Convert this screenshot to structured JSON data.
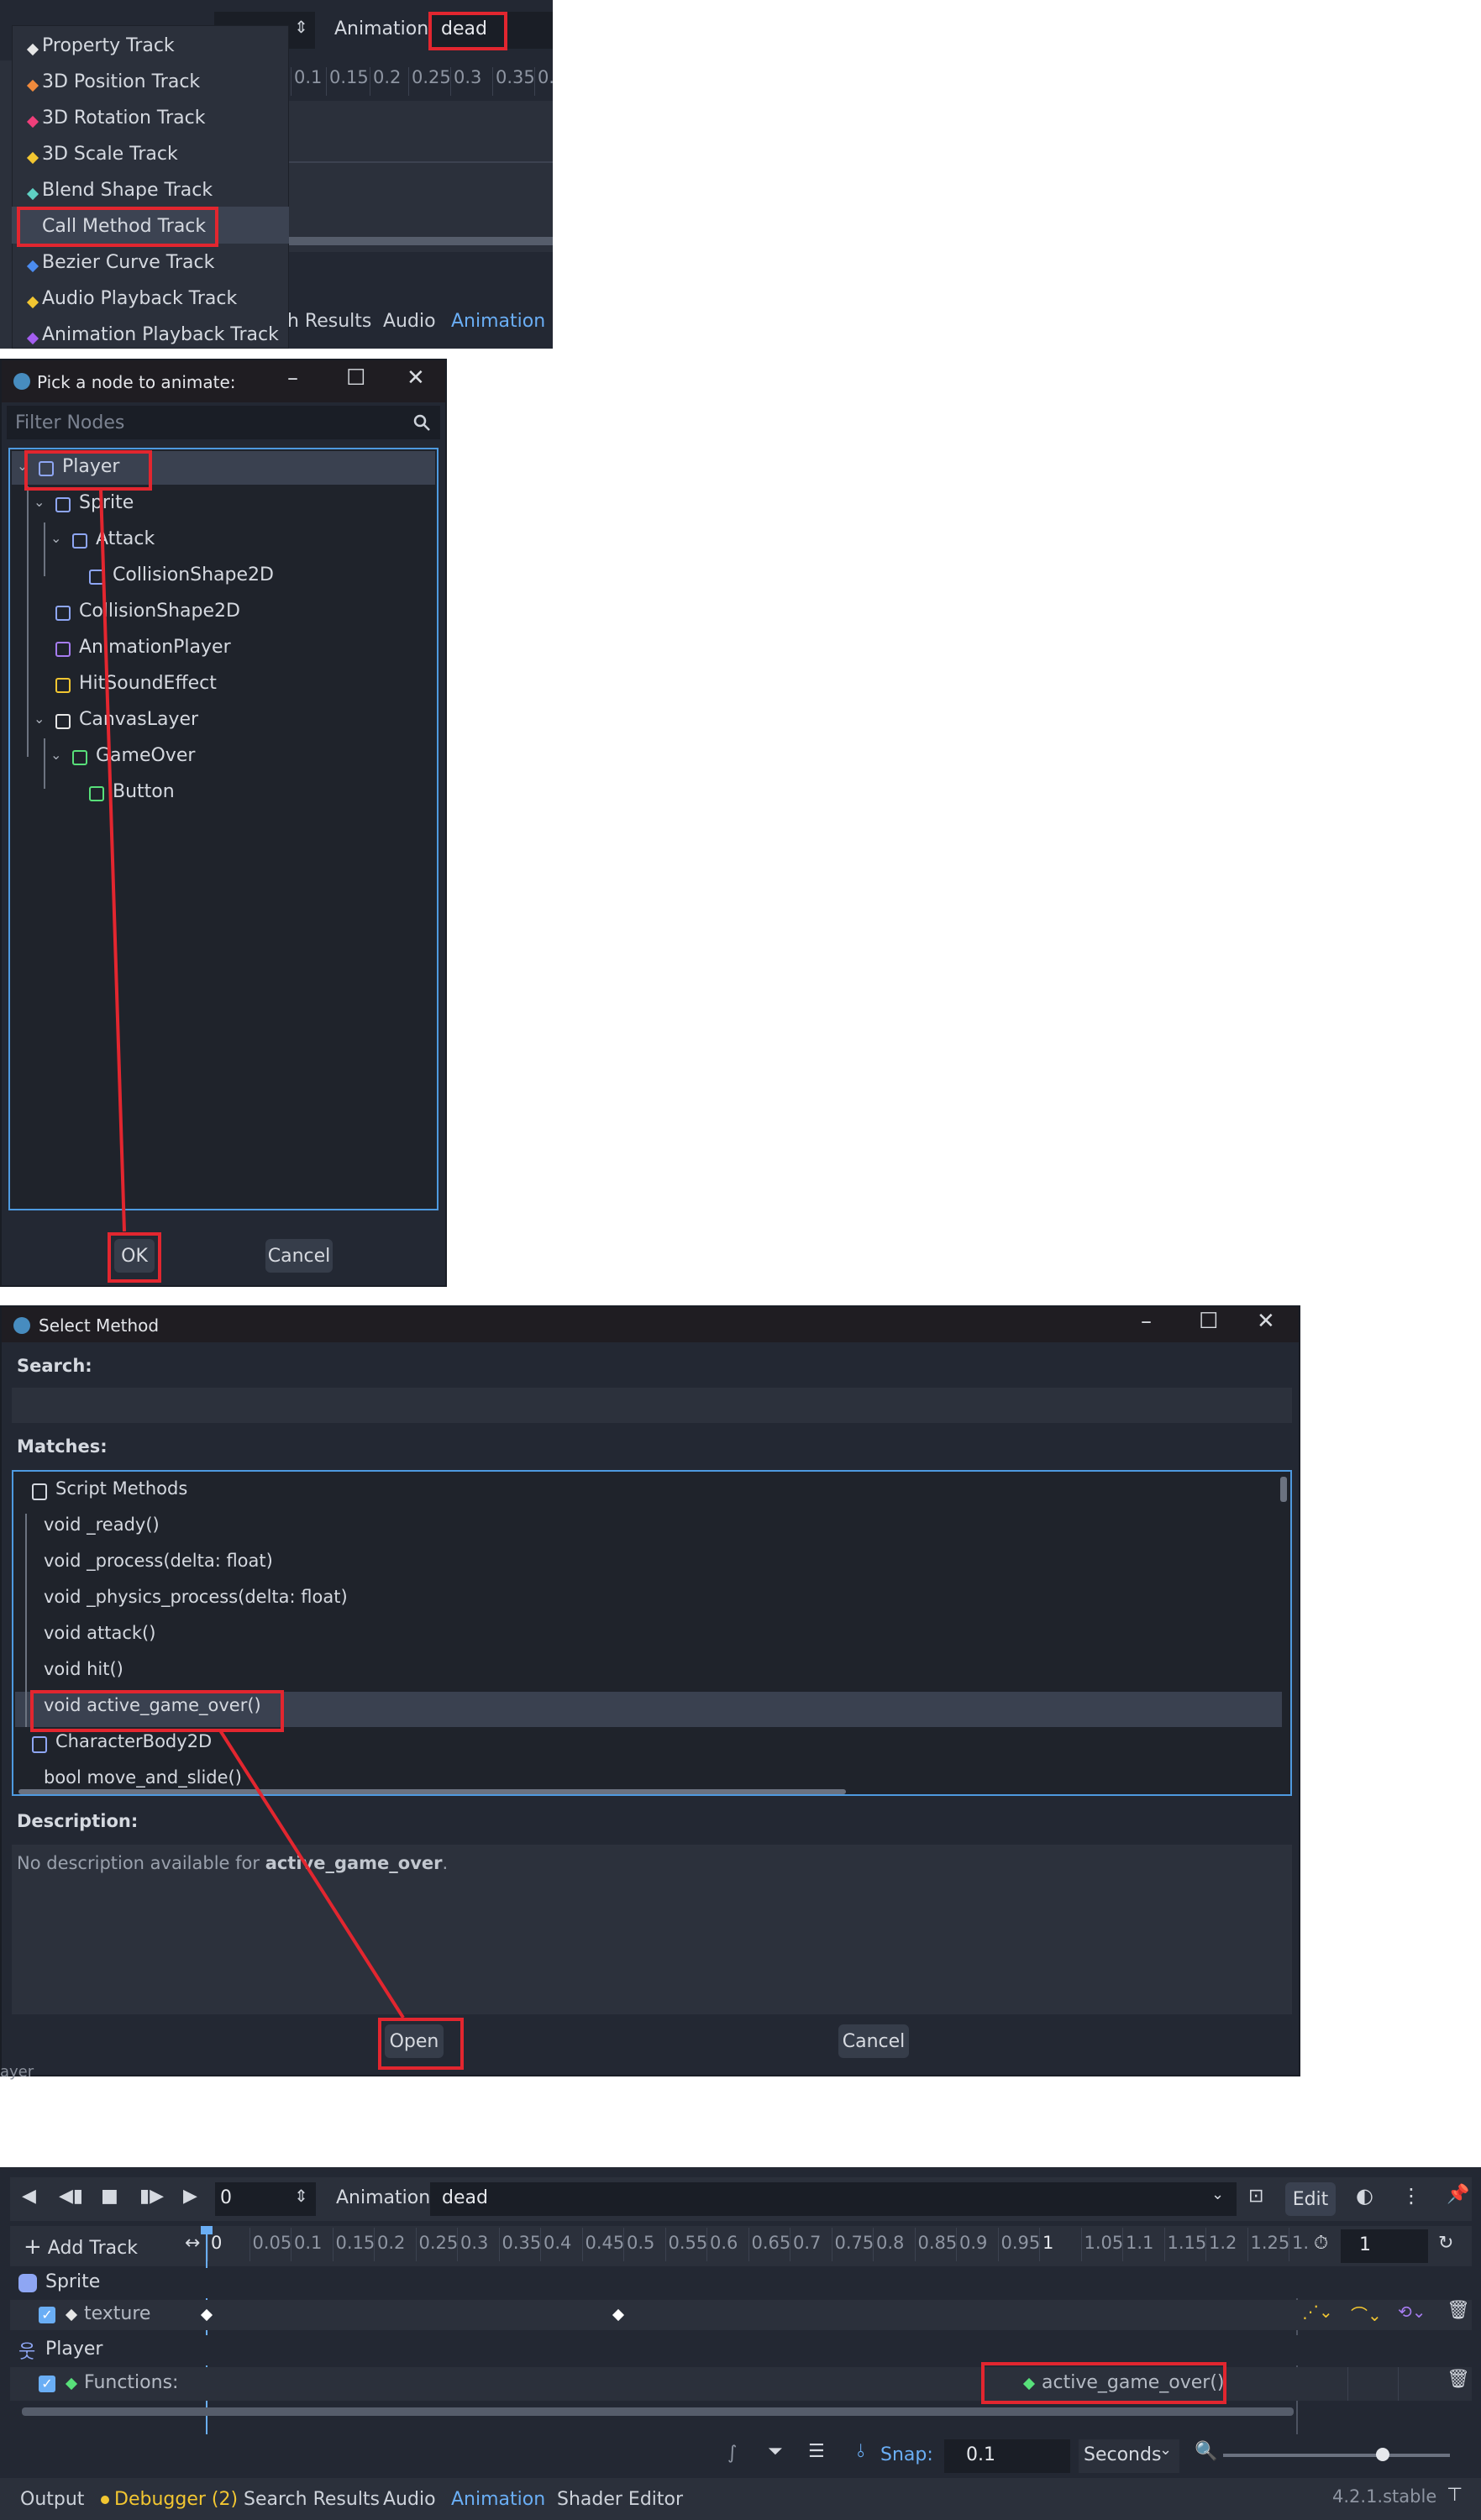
{
  "panel1": {
    "menu": [
      {
        "label": "Property Track",
        "color": "#e6e6e6"
      },
      {
        "label": "3D Position Track",
        "color": "#f08a3c"
      },
      {
        "label": "3D Rotation Track",
        "color": "#ef3f7a"
      },
      {
        "label": "3D Scale Track",
        "color": "#f2c631"
      },
      {
        "label": "Blend Shape Track",
        "color": "#5fd1c4"
      },
      {
        "label": "Call Method Track",
        "color": "#58e07a"
      },
      {
        "label": "Bezier Curve Track",
        "color": "#4b8cf0"
      },
      {
        "label": "Audio Playback Track",
        "color": "#f2c631"
      },
      {
        "label": "Animation Playback Track",
        "color": "#a45ef0"
      }
    ],
    "animation_label": "Animation",
    "animation_value": "dead",
    "ticks": [
      "0.1",
      "0.15",
      "0.2",
      "0.25",
      "0.3",
      "0.35",
      "0."
    ],
    "bottom_tabs": [
      "h Results",
      "Audio",
      "Animation"
    ]
  },
  "panel2": {
    "title": "Pick a node to animate:",
    "filter_placeholder": "Filter Nodes",
    "nodes": [
      {
        "label": "Player",
        "icon": "character-body-icon"
      },
      {
        "label": "Sprite",
        "icon": "sprite-icon"
      },
      {
        "label": "Attack",
        "icon": "area2d-icon"
      },
      {
        "label": "CollisionShape2D",
        "icon": "collision-shape-icon"
      },
      {
        "label": "CollisionShape2D",
        "icon": "collision-shape-icon"
      },
      {
        "label": "AnimationPlayer",
        "icon": "animation-player-icon"
      },
      {
        "label": "HitSoundEffect",
        "icon": "audio-player-icon"
      },
      {
        "label": "CanvasLayer",
        "icon": "canvas-layer-icon"
      },
      {
        "label": "GameOver",
        "icon": "control-icon"
      },
      {
        "label": "Button",
        "icon": "button-icon"
      }
    ],
    "ok": "OK",
    "cancel": "Cancel"
  },
  "panel3": {
    "title": "Select Method",
    "search_label": "Search:",
    "matches_label": "Matches:",
    "methods": [
      "Script Methods",
      "void _ready()",
      "void _process(delta: float)",
      "void _physics_process(delta: float)",
      "void attack()",
      "void hit()",
      "void active_game_over()",
      "CharacterBody2D",
      "bool move_and_slide()"
    ],
    "description_label": "Description:",
    "description_prefix": "No description available for ",
    "description_method": "active_game_over",
    "description_suffix": ".",
    "open": "Open",
    "cancel": "Cancel",
    "behind_text": "ayer"
  },
  "panel4": {
    "time_value": "0",
    "animation_label": "Animation",
    "animation_value": "dead",
    "edit": "Edit",
    "add_track": "Add Track",
    "ticks": [
      "0",
      "0.05",
      "0.1",
      "0.15",
      "0.2",
      "0.25",
      "0.3",
      "0.35",
      "0.4",
      "0.45",
      "0.5",
      "0.55",
      "0.6",
      "0.65",
      "0.7",
      "0.75",
      "0.8",
      "0.85",
      "0.9",
      "0.95",
      "1",
      "1.05",
      "1.1",
      "1.15",
      "1.2",
      "1.25",
      "1."
    ],
    "length_value": "1",
    "group1": "Sprite",
    "track1": "texture",
    "group2": "Player",
    "track2": "Functions:",
    "key_label": "active_game_over()",
    "snap_label": "Snap:",
    "snap_value": "0.1",
    "snap_unit": "Seconds",
    "bottom_tabs": [
      "Output",
      "Debugger (2)",
      "Search Results",
      "Audio",
      "Animation",
      "Shader Editor"
    ],
    "version": "4.2.1.stable"
  }
}
